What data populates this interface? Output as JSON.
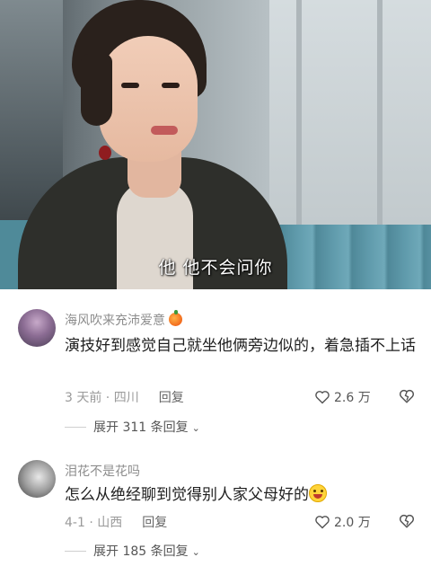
{
  "video": {
    "subtitle": "他 他不会问你"
  },
  "comments": [
    {
      "username": "海风吹来充沛爱意",
      "has_badge": true,
      "text": "演技好到感觉自己就坐他俩旁边似的，着急插不上话",
      "time_location": "3 天前 · 四川",
      "reply_label": "回复",
      "likes": "2.6 万",
      "expand_label": "展开 311 条回复"
    },
    {
      "username": "泪花不是花吗",
      "has_badge": false,
      "text": "怎么从绝经聊到觉得别人家父母好的",
      "time_location": "4-1 · 山西",
      "reply_label": "回复",
      "likes": "2.0 万",
      "expand_label": "展开 185 条回复"
    }
  ],
  "icons": {
    "like": "heart-outline-icon",
    "dislike": "broken-heart-icon",
    "expand": "chevron-down-icon",
    "badge": "orange-fan-badge-icon",
    "emoji": "grinning-face-emoji"
  },
  "colors": {
    "username": "#8d8d8d",
    "meta": "#9a9a9a",
    "text": "#1f1f1f"
  }
}
